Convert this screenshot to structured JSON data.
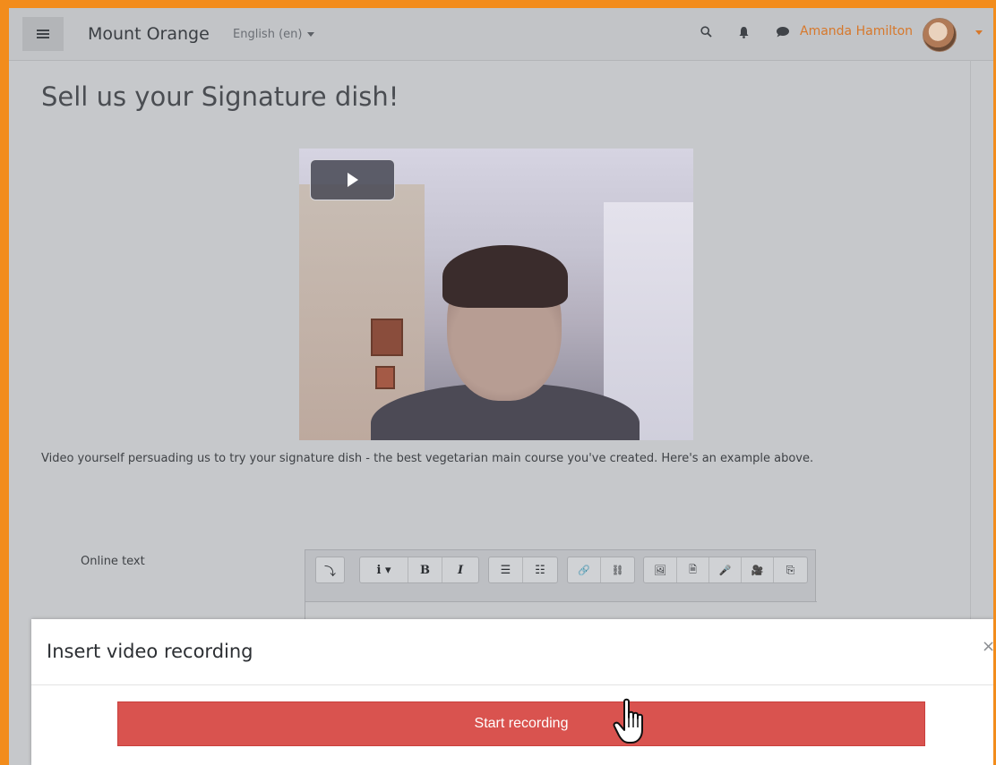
{
  "navbar": {
    "brand": "Mount Orange",
    "language": "English (en)",
    "user_name": "Amanda Hamilton",
    "icons": [
      "menu-icon",
      "search-icon",
      "bell-icon",
      "chat-icon",
      "chevron-down-icon"
    ]
  },
  "page": {
    "title": "Sell us your Signature dish!",
    "description": "Video yourself persuading us to try your signature dish - the best vegetarian main course you've created. Here's an example above.",
    "field_label": "Online text"
  },
  "video": {
    "play_icon": "play-icon"
  },
  "editor_toolbar": {
    "groups": [
      [
        "⤵"
      ],
      [
        "i ▾",
        "B",
        "I"
      ],
      [
        "☰",
        "☷"
      ],
      [
        "🔗",
        "⛓"
      ],
      [
        "🖼",
        "🗎",
        "🎤",
        "🎥",
        "⎘"
      ]
    ]
  },
  "modal": {
    "title": "Insert video recording",
    "close": "×",
    "start_button": "Start recording"
  },
  "colors": {
    "accent_border": "#f28c1c",
    "danger_button": "#d9534f",
    "user_name": "#d7782b"
  }
}
